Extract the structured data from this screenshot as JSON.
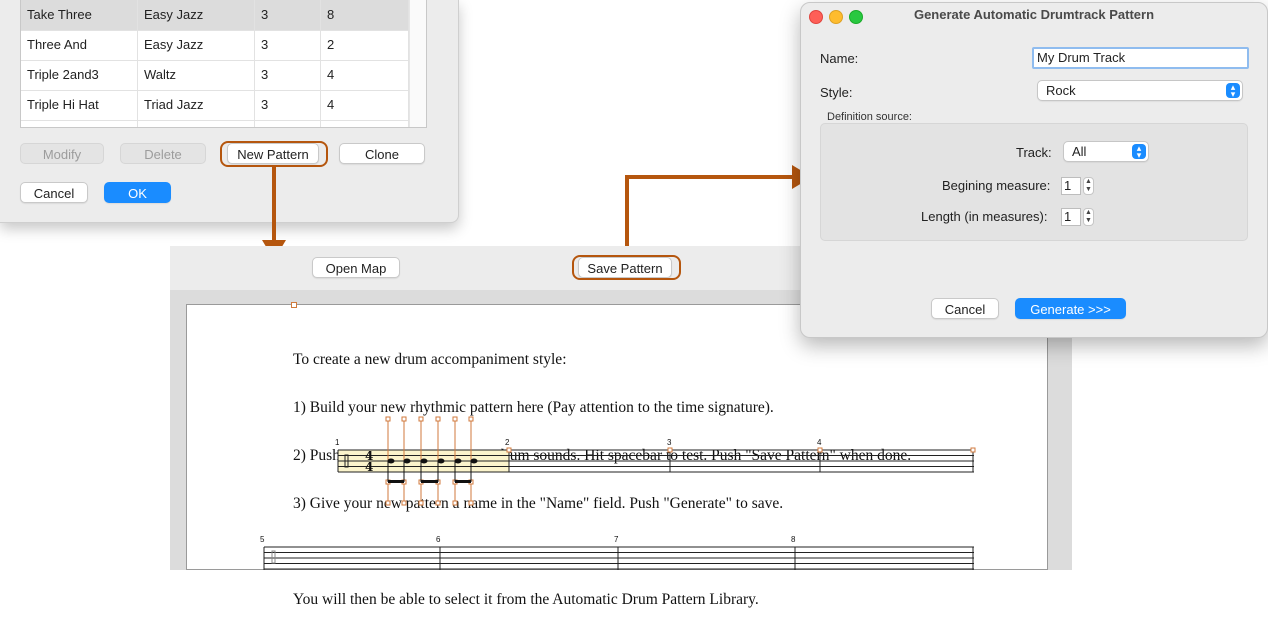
{
  "library": {
    "rows": [
      {
        "name": "Take Three",
        "style": "Easy Jazz",
        "beats": "3",
        "measures": "8",
        "selected": true
      },
      {
        "name": "Three And",
        "style": "Easy Jazz",
        "beats": "3",
        "measures": "2"
      },
      {
        "name": "Triple 2and3",
        "style": "Waltz",
        "beats": "3",
        "measures": "4"
      },
      {
        "name": "Triple Hi Hat",
        "style": "Triad Jazz",
        "beats": "3",
        "measures": "4"
      }
    ],
    "modify_label": "Modify",
    "delete_label": "Delete",
    "new_pattern_label": "New Pattern",
    "clone_label": "Clone",
    "cancel_label": "Cancel",
    "ok_label": "OK"
  },
  "editor": {
    "open_map_label": "Open Map",
    "save_pattern_label": "Save Pattern",
    "instructions": [
      "To create a new drum accompaniment style:",
      "1) Build your new rhythmic pattern here (Pay attention to the time signature).",
      "2) Push \"Open Map\" to reassign drum sounds. Hit spacebar to test. Push \"Save Pattern\" when done.",
      "3) Give your new pattern a name in the \"Name\" field. Push \"Generate\" to save.",
      "",
      "You will then be able to select it from the Automatic Drum Pattern Library."
    ],
    "measure_numbers_row1": [
      "1",
      "2",
      "3",
      "4"
    ],
    "measure_numbers_row2": [
      "5",
      "6",
      "7",
      "8"
    ],
    "time_signature": {
      "top": "4",
      "bottom": "4"
    }
  },
  "dialog": {
    "title": "Generate Automatic Drumtrack Pattern",
    "name_label": "Name:",
    "name_value": "My Drum Track",
    "style_label": "Style:",
    "style_value": "Rock",
    "definition_source_label": "Definition source:",
    "track_label": "Track:",
    "track_value": "All",
    "begin_label": "Begining measure:",
    "begin_value": "1",
    "length_label": "Length (in measures):",
    "length_value": "1",
    "cancel_label": "Cancel",
    "generate_label": "Generate >>>"
  },
  "colors": {
    "callout": "#b5560e",
    "accent": "#1a8cff",
    "highlight": "#fbf4cc"
  }
}
